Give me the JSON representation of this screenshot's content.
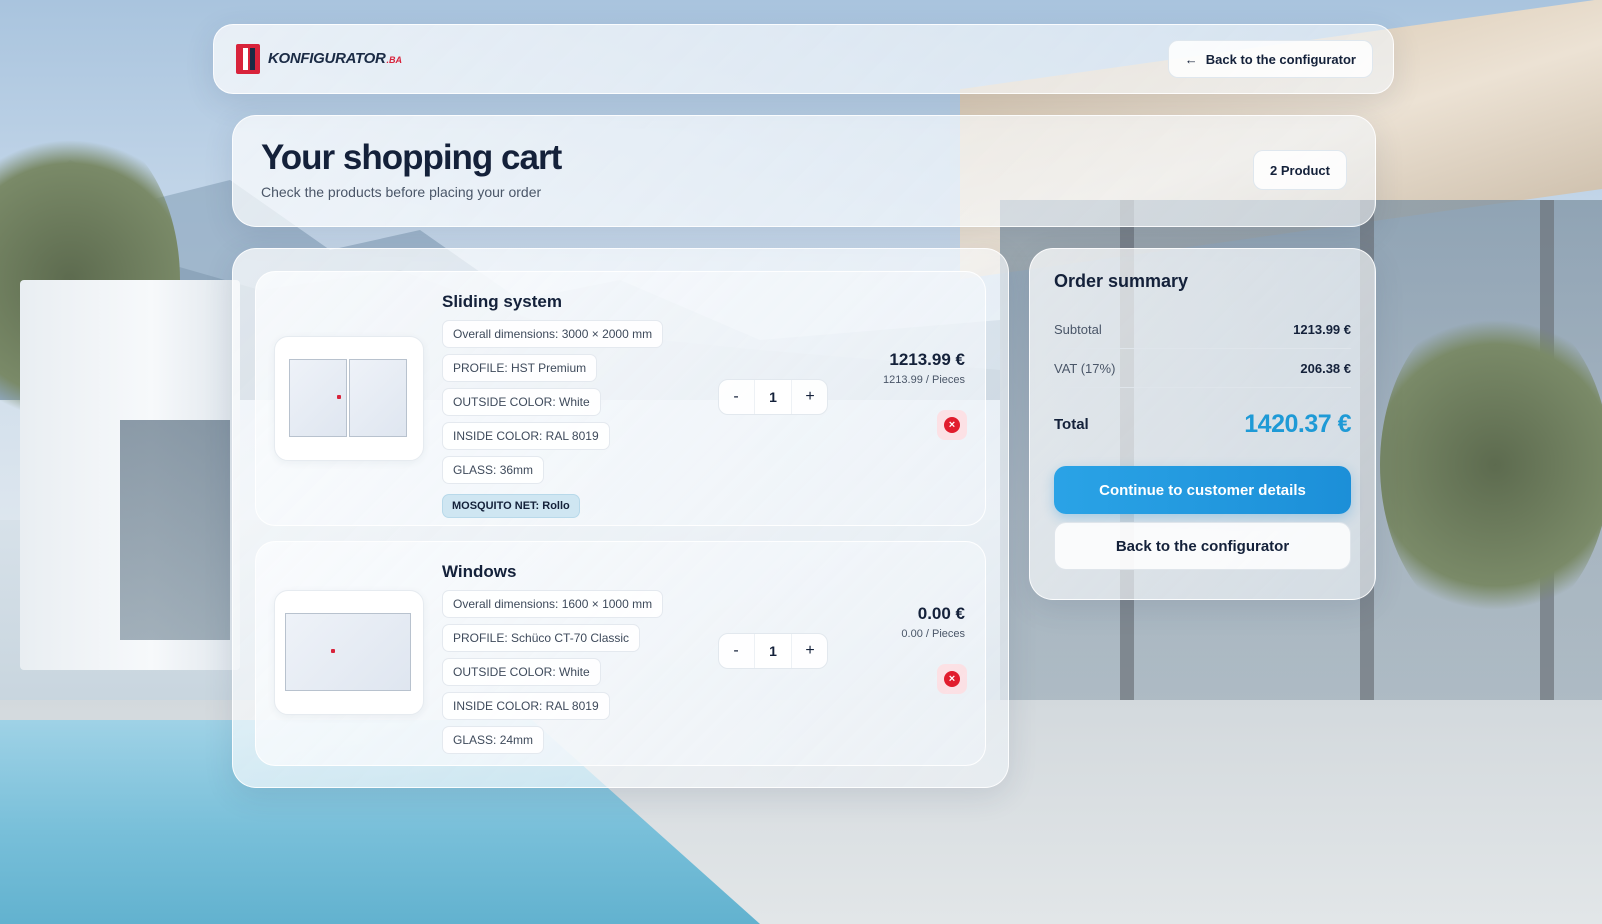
{
  "header": {
    "logo_text": "KONFIGURATOR",
    "logo_tld": ".BA",
    "back_arrow": "←",
    "back_label": "Back to the configurator"
  },
  "page": {
    "title": "Your shopping cart",
    "subtitle": "Check the products before placing your order",
    "count_badge": "2 Product"
  },
  "cart": {
    "items": [
      {
        "name": "Sliding system",
        "specs": [
          "Overall dimensions: 3000 × 2000 mm",
          "PROFILE: HST Premium",
          "OUTSIDE COLOR: White",
          "INSIDE COLOR: RAL 8019",
          "GLASS: 36mm"
        ],
        "extra": "MOSQUITO NET: Rollo",
        "quantity": "1",
        "price": "1213.99 €",
        "unit_price": "1213.99 / Pieces"
      },
      {
        "name": "Windows",
        "specs": [
          "Overall dimensions: 1600 × 1000 mm",
          "PROFILE: Schüco CT-70 Classic",
          "OUTSIDE COLOR: White",
          "INSIDE COLOR: RAL 8019",
          "GLASS: 24mm"
        ],
        "quantity": "1",
        "price": "0.00 €",
        "unit_price": "0.00 / Pieces"
      }
    ],
    "minus": "-",
    "plus": "+"
  },
  "summary": {
    "title": "Order summary",
    "subtotal_label": "Subtotal",
    "subtotal_value": "1213.99 €",
    "vat_label": "VAT (17%)",
    "vat_value": "206.38 €",
    "total_label": "Total",
    "total_value": "1420.37 €",
    "primary_button": "Continue to customer details",
    "secondary_button": "Back to the configurator"
  },
  "colors": {
    "brand_red": "#d8233b",
    "accent_blue": "#1e9ad6",
    "remove_red": "#e11d2e"
  },
  "icons": {
    "remove": "close-circle-icon",
    "back": "arrow-left-icon"
  }
}
